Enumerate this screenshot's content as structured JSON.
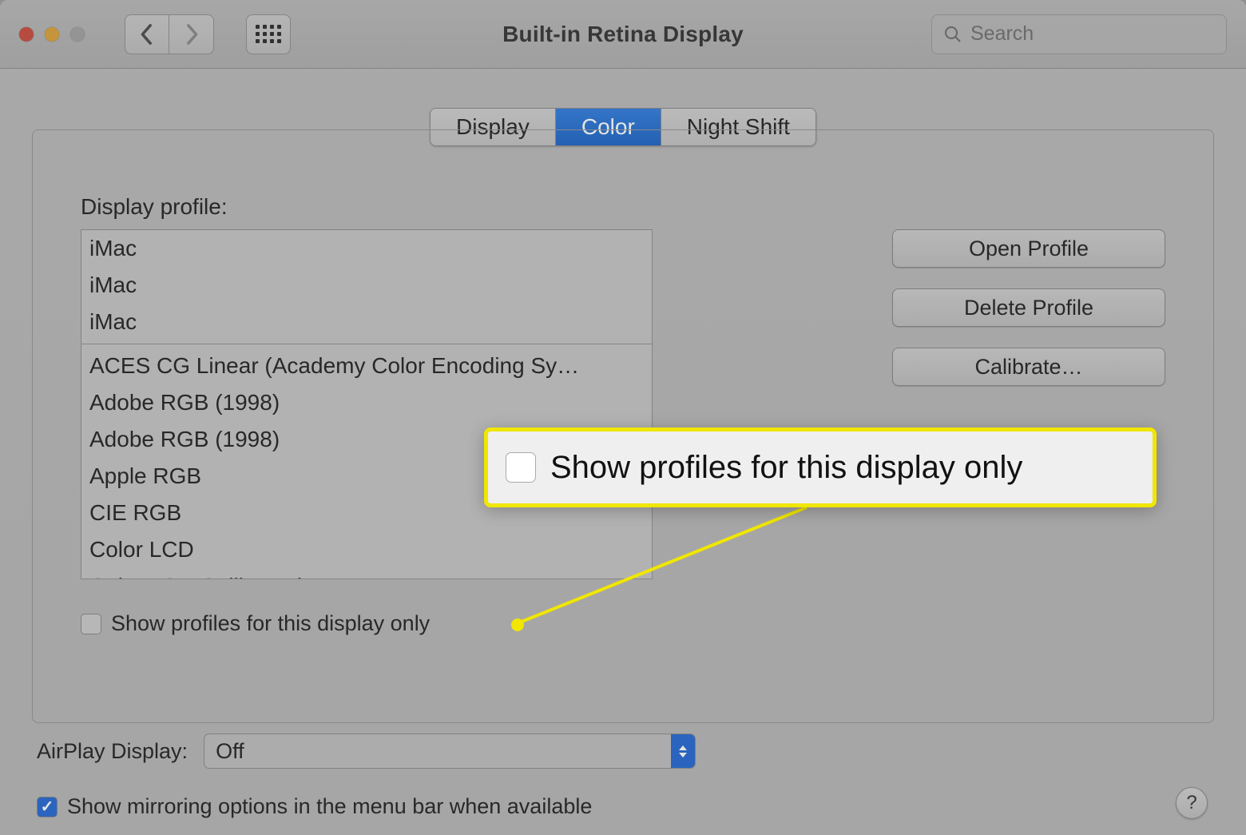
{
  "window": {
    "title": "Built-in Retina Display",
    "search_placeholder": "Search"
  },
  "tabs": {
    "display": "Display",
    "color": "Color",
    "night_shift": "Night Shift"
  },
  "profile_section": {
    "label": "Display profile:",
    "items_top": [
      "iMac",
      "iMac",
      "iMac"
    ],
    "items_bottom": [
      "ACES CG Linear (Academy Color Encoding Sy…",
      "Adobe RGB (1998)",
      "Adobe RGB (1998)",
      "Apple RGB",
      "CIE RGB",
      "Color LCD",
      "Color LCD Calibrated"
    ]
  },
  "buttons": {
    "open_profile": "Open Profile",
    "delete_profile": "Delete Profile",
    "calibrate": "Calibrate…"
  },
  "checkbox": {
    "show_profiles_only": "Show profiles for this display only"
  },
  "airplay": {
    "label": "AirPlay Display:",
    "value": "Off"
  },
  "mirror": {
    "label": "Show mirroring options in the menu bar when available"
  },
  "callout": {
    "label": "Show profiles for this display only"
  },
  "help": "?"
}
